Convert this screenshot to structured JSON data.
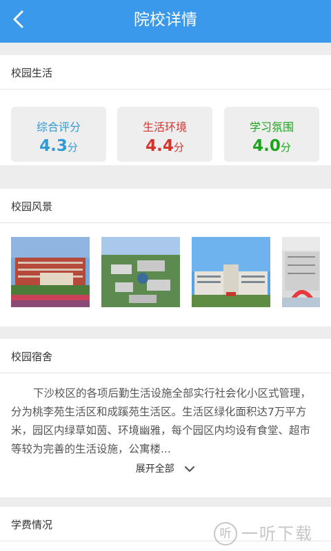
{
  "header": {
    "title": "院校详情",
    "back_icon": "chevron-left-icon"
  },
  "campus_life": {
    "title": "校园生活",
    "ratings": [
      {
        "label": "综合评分",
        "value": "4.3",
        "unit": "分",
        "color": "#2f9ad6"
      },
      {
        "label": "生活环境",
        "value": "4.4",
        "unit": "分",
        "color": "#d6322e"
      },
      {
        "label": "学习氛围",
        "value": "4.0",
        "unit": "分",
        "color": "#1da41d"
      }
    ]
  },
  "scenery": {
    "title": "校园风景",
    "images": [
      {
        "name": "campus-photo-1"
      },
      {
        "name": "campus-photo-2"
      },
      {
        "name": "campus-photo-3"
      },
      {
        "name": "campus-photo-4"
      }
    ]
  },
  "dorm": {
    "title": "校园宿舍",
    "text": "下沙校区的各项后勤生活设施全部实行社会化小区式管理，分为桃李苑生活区和成蹊苑生活区。生活区绿化面积达7万平方米，园区内绿草如茵、环境幽雅，每个园区内均设有食堂、超市等较为完善的生活设施，公寓楼...",
    "expand_label": "展开全部"
  },
  "tuition": {
    "title": "学费情况"
  },
  "watermark": {
    "mark": "听",
    "text": "一听下载"
  }
}
